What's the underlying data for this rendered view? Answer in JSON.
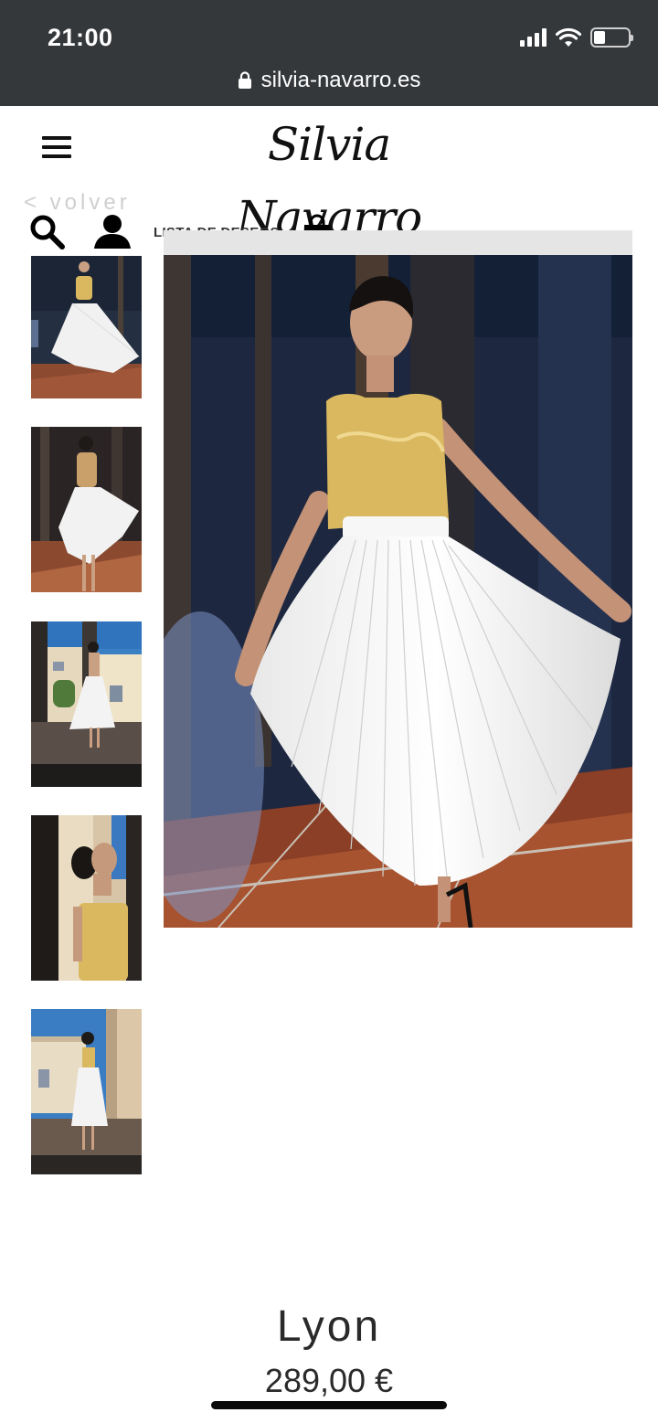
{
  "status": {
    "time": "21:00"
  },
  "browser": {
    "url": "silvia-navarro.es"
  },
  "header": {
    "logo_text": "Silvia Navarro",
    "back_label": "< volver",
    "wishlist_label": "LISTA DE DESEOS"
  },
  "icons": {
    "menu": "hamburger-menu-icon",
    "search": "search-icon",
    "account": "user-icon",
    "bag": "shopping-bag-icon",
    "lock": "lock-icon"
  },
  "gallery": {
    "thumbnail_count": 5
  },
  "product": {
    "name": "Lyon",
    "price": "289,00 €"
  },
  "colors": {
    "status_bar": "#35383b",
    "gold_bodice": "#d9b860",
    "white_skirt": "#f4f4f4",
    "floor_tile": "#9a4a2c"
  }
}
